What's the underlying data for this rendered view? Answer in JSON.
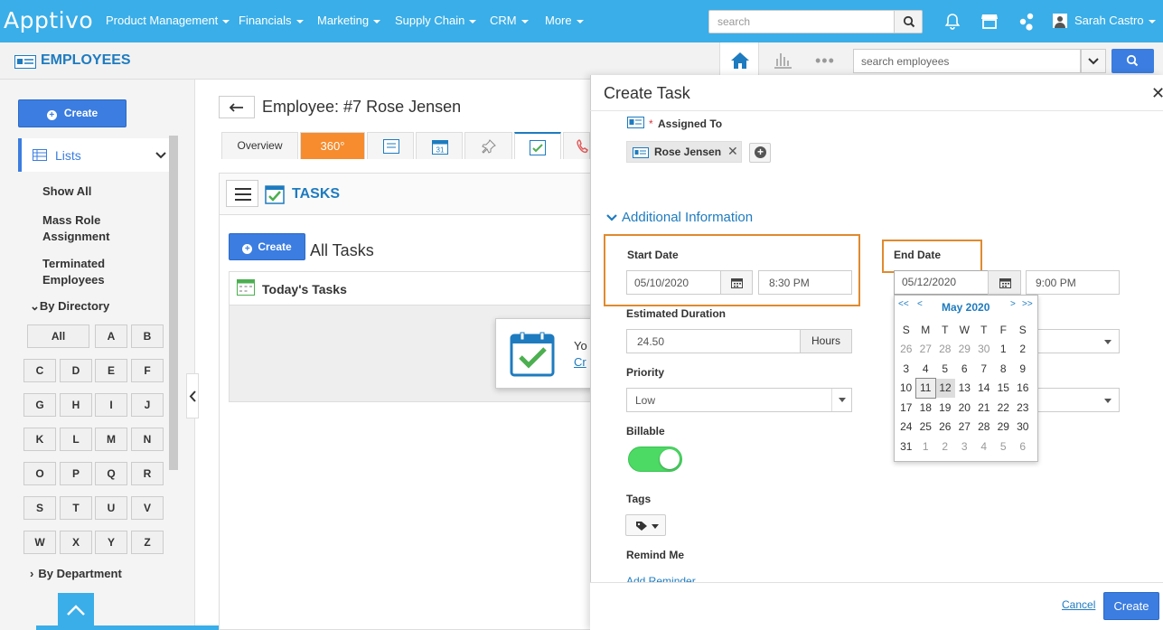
{
  "app": {
    "logo": "Apptivo",
    "user": "Sarah Castro",
    "search_placeholder": "search"
  },
  "nav": [
    "Product Management",
    "Financials",
    "Marketing",
    "Supply Chain",
    "CRM",
    "More"
  ],
  "module": {
    "title": "EMPLOYEES",
    "search_placeholder": "search employees"
  },
  "sidebar": {
    "create": "Create",
    "lists": "Lists",
    "items": [
      "Show All",
      "Mass Role Assignment",
      "Terminated Employees"
    ],
    "by_directory": "By Directory",
    "by_department": "By Department",
    "letters": [
      "All",
      "A",
      "B",
      "C",
      "D",
      "E",
      "F",
      "G",
      "H",
      "I",
      "J",
      "K",
      "L",
      "M",
      "N",
      "O",
      "P",
      "Q",
      "R",
      "S",
      "T",
      "U",
      "V",
      "W",
      "X",
      "Y",
      "Z"
    ]
  },
  "employee": {
    "title": "Employee: #7 Rose Jensen",
    "tabs": [
      "Overview",
      "360°"
    ],
    "section": "TASKS",
    "create": "Create",
    "all_tasks": "All Tasks",
    "todays": "Today's Tasks",
    "popup_text": "Yo",
    "popup_link": "Cr"
  },
  "task": {
    "title": "Create Task",
    "assigned_label": "Assigned To",
    "assignee": "Rose Jensen",
    "additional": "Additional Information",
    "start_label": "Start Date",
    "start_date": "05/10/2020",
    "start_time": "8:30 PM",
    "end_label": "End Date",
    "end_date": "05/12/2020",
    "end_time": "9:00 PM",
    "duration_label": "Estimated Duration",
    "duration": "24.50",
    "duration_unit": "Hours",
    "priority_label": "Priority",
    "priority": "Low",
    "billable_label": "Billable",
    "billable_on": true,
    "tags_label": "Tags",
    "remind_label": "Remind Me",
    "add_reminder": "Add Reminder",
    "cancel": "Cancel",
    "create": "Create"
  },
  "calendar": {
    "month": "May 2020",
    "prev2": "<<",
    "prev": "<",
    "next": ">",
    "next2": ">>",
    "weekdays": [
      "S",
      "M",
      "T",
      "W",
      "T",
      "F",
      "S"
    ],
    "weeks": [
      [
        "26",
        "27",
        "28",
        "29",
        "30",
        "1",
        "2"
      ],
      [
        "3",
        "4",
        "5",
        "6",
        "7",
        "8",
        "9"
      ],
      [
        "10",
        "11",
        "12",
        "13",
        "14",
        "15",
        "16"
      ],
      [
        "17",
        "18",
        "19",
        "20",
        "21",
        "22",
        "23"
      ],
      [
        "24",
        "25",
        "26",
        "27",
        "28",
        "29",
        "30"
      ],
      [
        "31",
        "1",
        "2",
        "3",
        "4",
        "5",
        "6"
      ]
    ],
    "today": "11",
    "selected": "12"
  },
  "colors": {
    "topbar": "#3aaee8",
    "accent": "#3b7de0",
    "highlight": "#e08a2e",
    "toggle": "#4cd964"
  }
}
